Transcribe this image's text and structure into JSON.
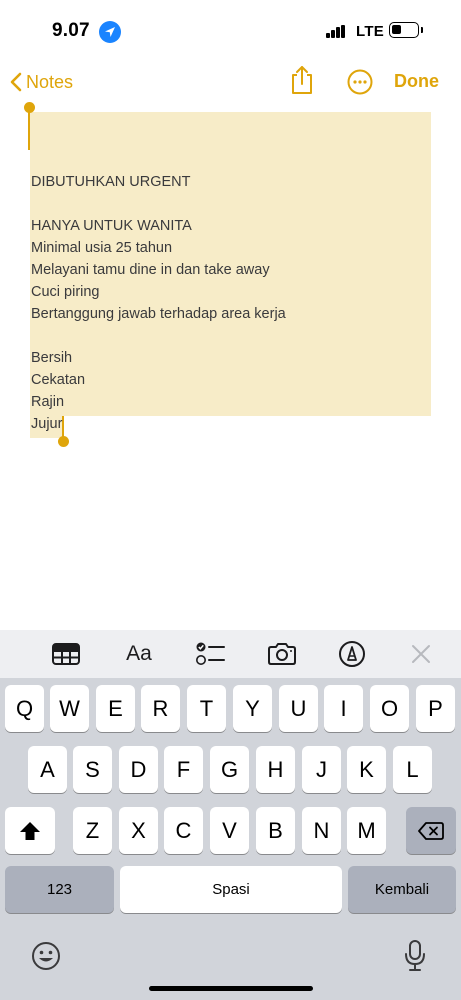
{
  "status_bar": {
    "time": "9.07",
    "network": "LTE",
    "location_icon": "location-arrow-icon",
    "battery_level": 0.4
  },
  "nav": {
    "back_label": "Notes",
    "done_label": "Done",
    "accent_color": "#dfa50b"
  },
  "note": {
    "lines": [
      "DIBUTUHKAN URGENT",
      "",
      "HANYA UNTUK WANITA",
      "Minimal usia 25 tahun",
      "Melayani tamu dine in dan take away",
      "Cuci piring",
      "Bertanggung jawab terhadap area kerja",
      "",
      "Bersih",
      "Cekatan",
      "Rajin",
      "Jujur"
    ],
    "selection_color": "#f7ecc8"
  },
  "toolbar": {
    "format_label": "Aa",
    "icons": [
      "table-icon",
      "format-icon",
      "checklist-icon",
      "camera-icon",
      "markup-icon",
      "close-icon"
    ]
  },
  "keyboard": {
    "row1": [
      "Q",
      "W",
      "E",
      "R",
      "T",
      "Y",
      "U",
      "I",
      "O",
      "P"
    ],
    "row2": [
      "A",
      "S",
      "D",
      "F",
      "G",
      "H",
      "J",
      "K",
      "L"
    ],
    "row3": [
      "Z",
      "X",
      "C",
      "V",
      "B",
      "N",
      "M"
    ],
    "numbers_label": "123",
    "space_label": "Spasi",
    "return_label": "Kembali"
  }
}
